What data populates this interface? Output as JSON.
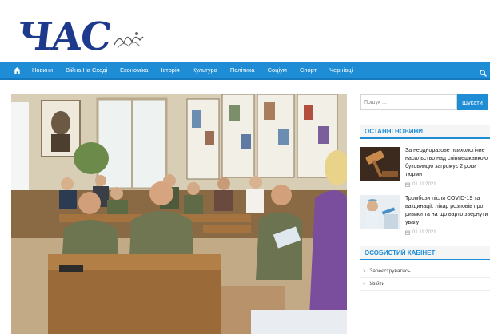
{
  "site": {
    "logo_text": "ЧАС",
    "accent": "#1f8dd6",
    "logo_color": "#1d3a8c"
  },
  "nav": {
    "home_icon": "home-icon",
    "items": [
      "Новини",
      "Війна На Сході",
      "Економіка",
      "Історія",
      "Культура",
      "Політика",
      "Соціум",
      "Спорт",
      "Чернівці"
    ],
    "search_icon": "search-icon"
  },
  "photo": {
    "icon": "photo-classroom-soldiers"
  },
  "sidebar": {
    "search": {
      "placeholder": "Пошук ...",
      "button": "Шукати"
    },
    "latest": {
      "title": "ОСТАННІ НОВИНИ",
      "items": [
        {
          "title": "За неодноразове психологічне насильство над співмешканкою буковинцю загрожує 2 роки тюрми",
          "date": "01.11.2021",
          "thumb": "gavel-thumb"
        },
        {
          "title": "Тромбози після COVID-19 та вакцинації: лікар розповів про ризики та на що варто звернути увагу",
          "date": "01.11.2021",
          "thumb": "vaccine-thumb"
        }
      ]
    },
    "cabinet": {
      "title": "ОСОБИСТИЙ КАБІНЕТ",
      "items": [
        "Зареєструватись",
        "Увійти"
      ]
    }
  }
}
